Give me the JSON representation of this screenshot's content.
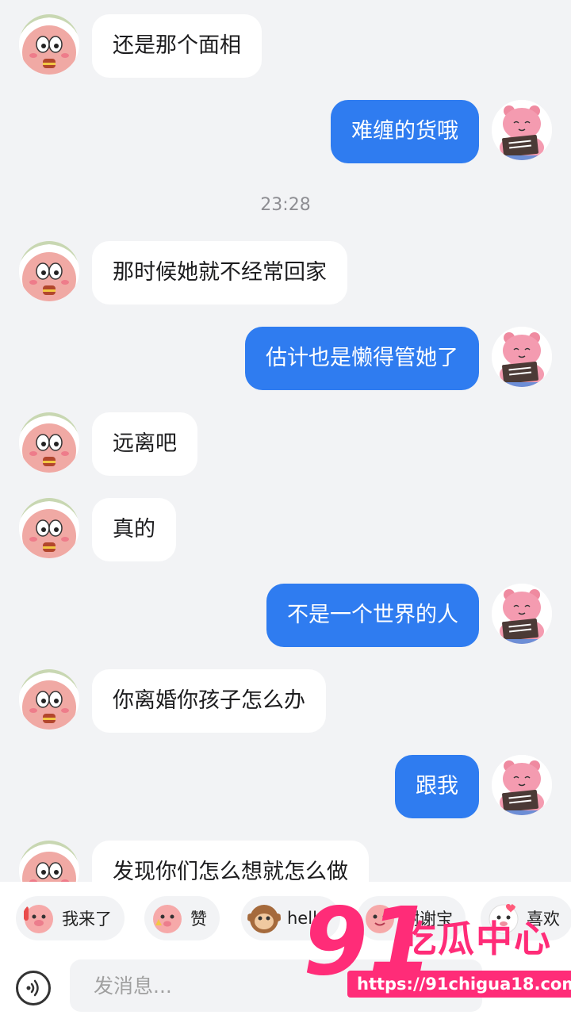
{
  "messages": [
    {
      "side": "left",
      "text": "还是那个面相"
    },
    {
      "side": "right",
      "text": "难缠的货哦"
    },
    {
      "side": "left",
      "text": "那时候她就不经常回家"
    },
    {
      "side": "right",
      "text": "估计也是懒得管她了"
    },
    {
      "side": "left",
      "text": "远离吧"
    },
    {
      "side": "left",
      "text": "真的"
    },
    {
      "side": "right",
      "text": "不是一个世界的人"
    },
    {
      "side": "left",
      "text": "你离婚你孩子怎么办"
    },
    {
      "side": "right",
      "text": "跟我"
    },
    {
      "side": "left",
      "text": "发现你们怎么想就怎么做"
    }
  ],
  "timestamp": "23:28",
  "quick_replies": [
    "我来了",
    "赞",
    "hello",
    "谢谢宝",
    "喜欢"
  ],
  "input": {
    "placeholder": "发消息..."
  },
  "watermark": {
    "number": "91",
    "name": "吃瓜中心",
    "url": "https://91chigua18.com"
  },
  "colors": {
    "sent_bubble": "#2f7cf0",
    "received_bubble": "#ffffff",
    "background": "#f2f3f5",
    "watermark": "#ff2c78"
  }
}
